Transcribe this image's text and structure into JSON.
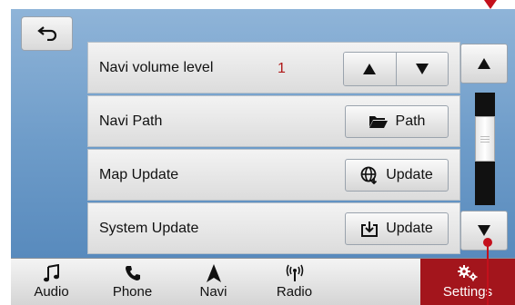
{
  "header": {
    "back_icon": "back-arrow-icon"
  },
  "settings_rows": [
    {
      "label": "Navi volume level",
      "value": "1"
    },
    {
      "label": "Navi Path",
      "button_label": "Path",
      "button_icon": "folder-icon"
    },
    {
      "label": "Map Update",
      "button_label": "Update",
      "button_icon": "globe-icon"
    },
    {
      "label": "System Update",
      "button_label": "Update",
      "button_icon": "download-icon"
    }
  ],
  "scrollbar": {
    "position": 0.35
  },
  "bottom_nav": [
    {
      "label": "Audio",
      "icon": "music-note-icon"
    },
    {
      "label": "Phone",
      "icon": "phone-icon"
    },
    {
      "label": "Navi",
      "icon": "navigation-arrow-icon"
    },
    {
      "label": "Radio",
      "icon": "radio-signal-icon"
    },
    {
      "label": "Settings",
      "icon": "gears-icon",
      "active": true
    }
  ],
  "colors": {
    "accent": "#a3151c",
    "value_text": "#b01818",
    "callout": "#c4101c"
  }
}
